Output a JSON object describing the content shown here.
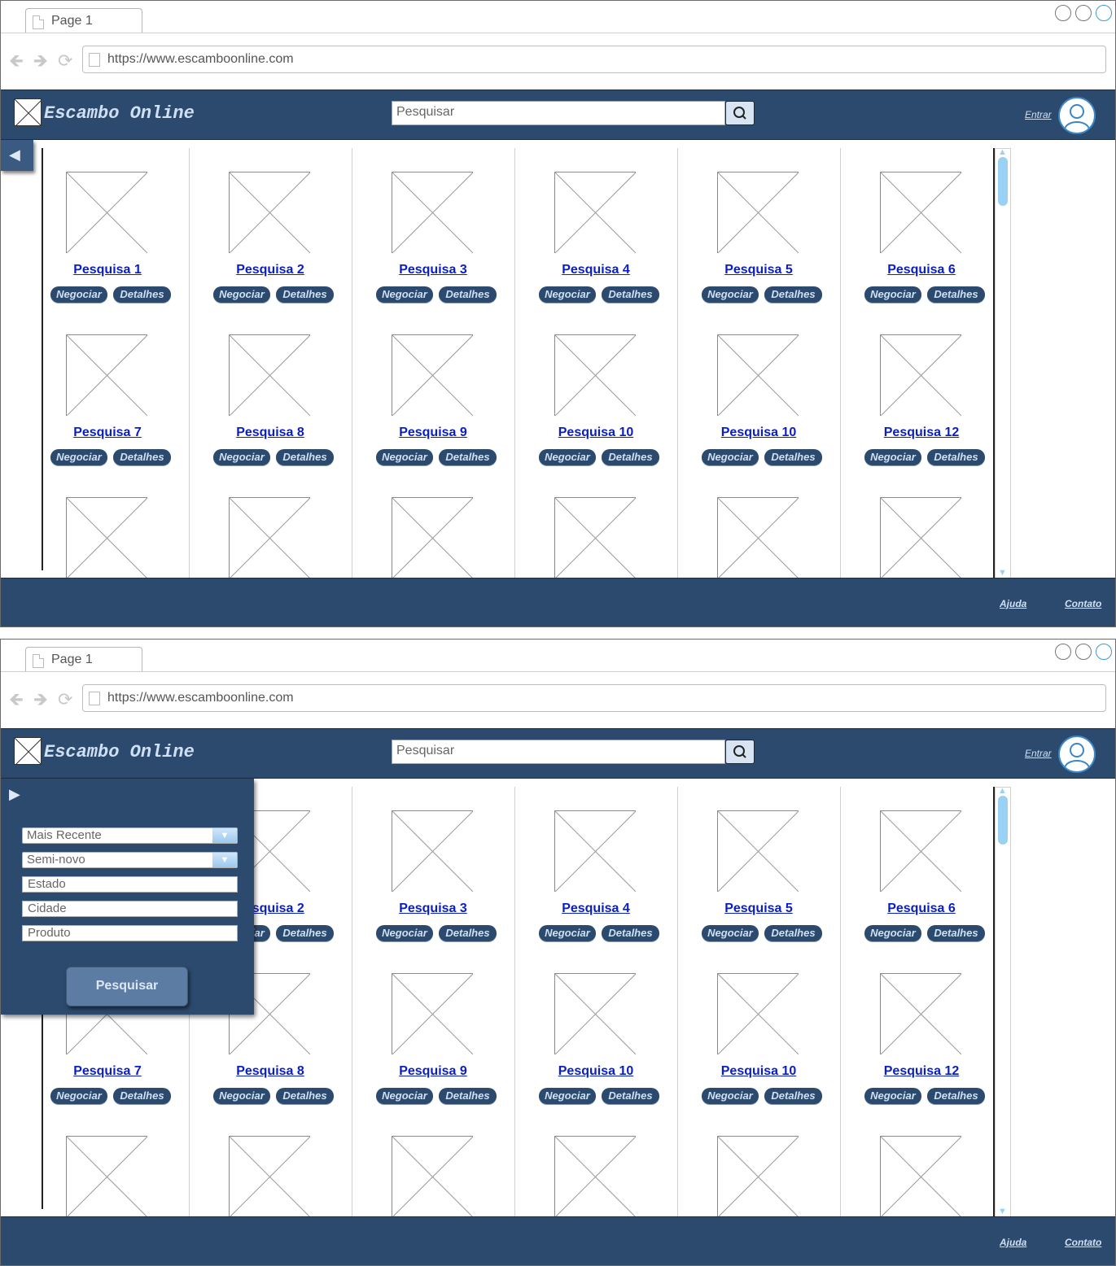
{
  "browser": {
    "tab_label": "Page 1",
    "url": "https://www.escamboonline.com"
  },
  "header": {
    "brand": "Escambo Online",
    "search_placeholder": "Pesquisar",
    "login_label": "Entrar"
  },
  "results": {
    "items": [
      {
        "name": "Pesquisa 1"
      },
      {
        "name": "Pesquisa 2"
      },
      {
        "name": "Pesquisa 3"
      },
      {
        "name": "Pesquisa 4"
      },
      {
        "name": "Pesquisa 5"
      },
      {
        "name": "Pesquisa 6"
      },
      {
        "name": "Pesquisa 7"
      },
      {
        "name": "Pesquisa 8"
      },
      {
        "name": "Pesquisa 9"
      },
      {
        "name": "Pesquisa 10"
      },
      {
        "name": "Pesquisa 10"
      },
      {
        "name": "Pesquisa 12"
      },
      {
        "name": ""
      },
      {
        "name": ""
      },
      {
        "name": ""
      },
      {
        "name": ""
      },
      {
        "name": ""
      },
      {
        "name": ""
      }
    ],
    "negotiate_label": "Negociar",
    "details_label": "Detalhes"
  },
  "filters": {
    "sort_value": "Mais Recente",
    "condition_value": "Semi-novo",
    "state_placeholder": "Estado",
    "city_placeholder": "Cidade",
    "product_placeholder": "Produto",
    "submit_label": "Pesquisar"
  },
  "footer": {
    "help_label": "Ajuda",
    "contact_label": "Contato"
  }
}
